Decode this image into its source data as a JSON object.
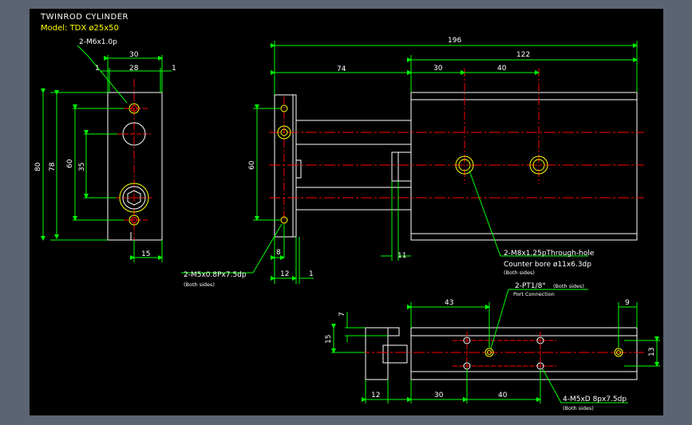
{
  "drawing": {
    "title": "TWINROD CYLINDER",
    "model": "Model: TDX ø25x50"
  },
  "left_view": {
    "thread_note": "2-M6x1.0p",
    "dims": {
      "width_30": "30",
      "inner_28": "28",
      "edge_left_1": "1",
      "edge_right_1": "1",
      "h_80": "80",
      "h_78": "78",
      "h_60": "60",
      "h_35": "35",
      "bottom_15": "15"
    }
  },
  "front_view": {
    "dims": {
      "overall_196": "196",
      "rod_74": "74",
      "body_122": "122",
      "offset_30": "30",
      "pitch_40": "40",
      "h_60": "60",
      "offset_8": "8",
      "plate_12": "12",
      "gap_1": "1",
      "flange_11": "11"
    },
    "note_left": "2-M5x0.8Px7.5dp",
    "note_left_sub": "(Both sides)",
    "note_right": "2-M8x1.25pThrough-hole",
    "note_right_2": "Counter bore ø11x6.3dp",
    "note_right_sub": "(Both sides)"
  },
  "bottom_view": {
    "dims": {
      "top_43": "43",
      "right_9": "9",
      "left_7": "7",
      "left_15": "15",
      "right_13": "13",
      "bottom_12": "12",
      "bottom_30": "30",
      "bottom_40": "40"
    },
    "port_note": "2-PT1/8°",
    "port_note_sub": "(Both sides)",
    "port_label": "Port Connection",
    "tap_note": "4-M5xD 8px7.5dp",
    "tap_note_sub": "(Both sides)"
  },
  "colors": {
    "background": "#000000",
    "frame": "#5a6472",
    "outline": "#ffffff",
    "dimension": "#00ff00",
    "centerline": "#ff0000",
    "holes": "#ffff00"
  }
}
